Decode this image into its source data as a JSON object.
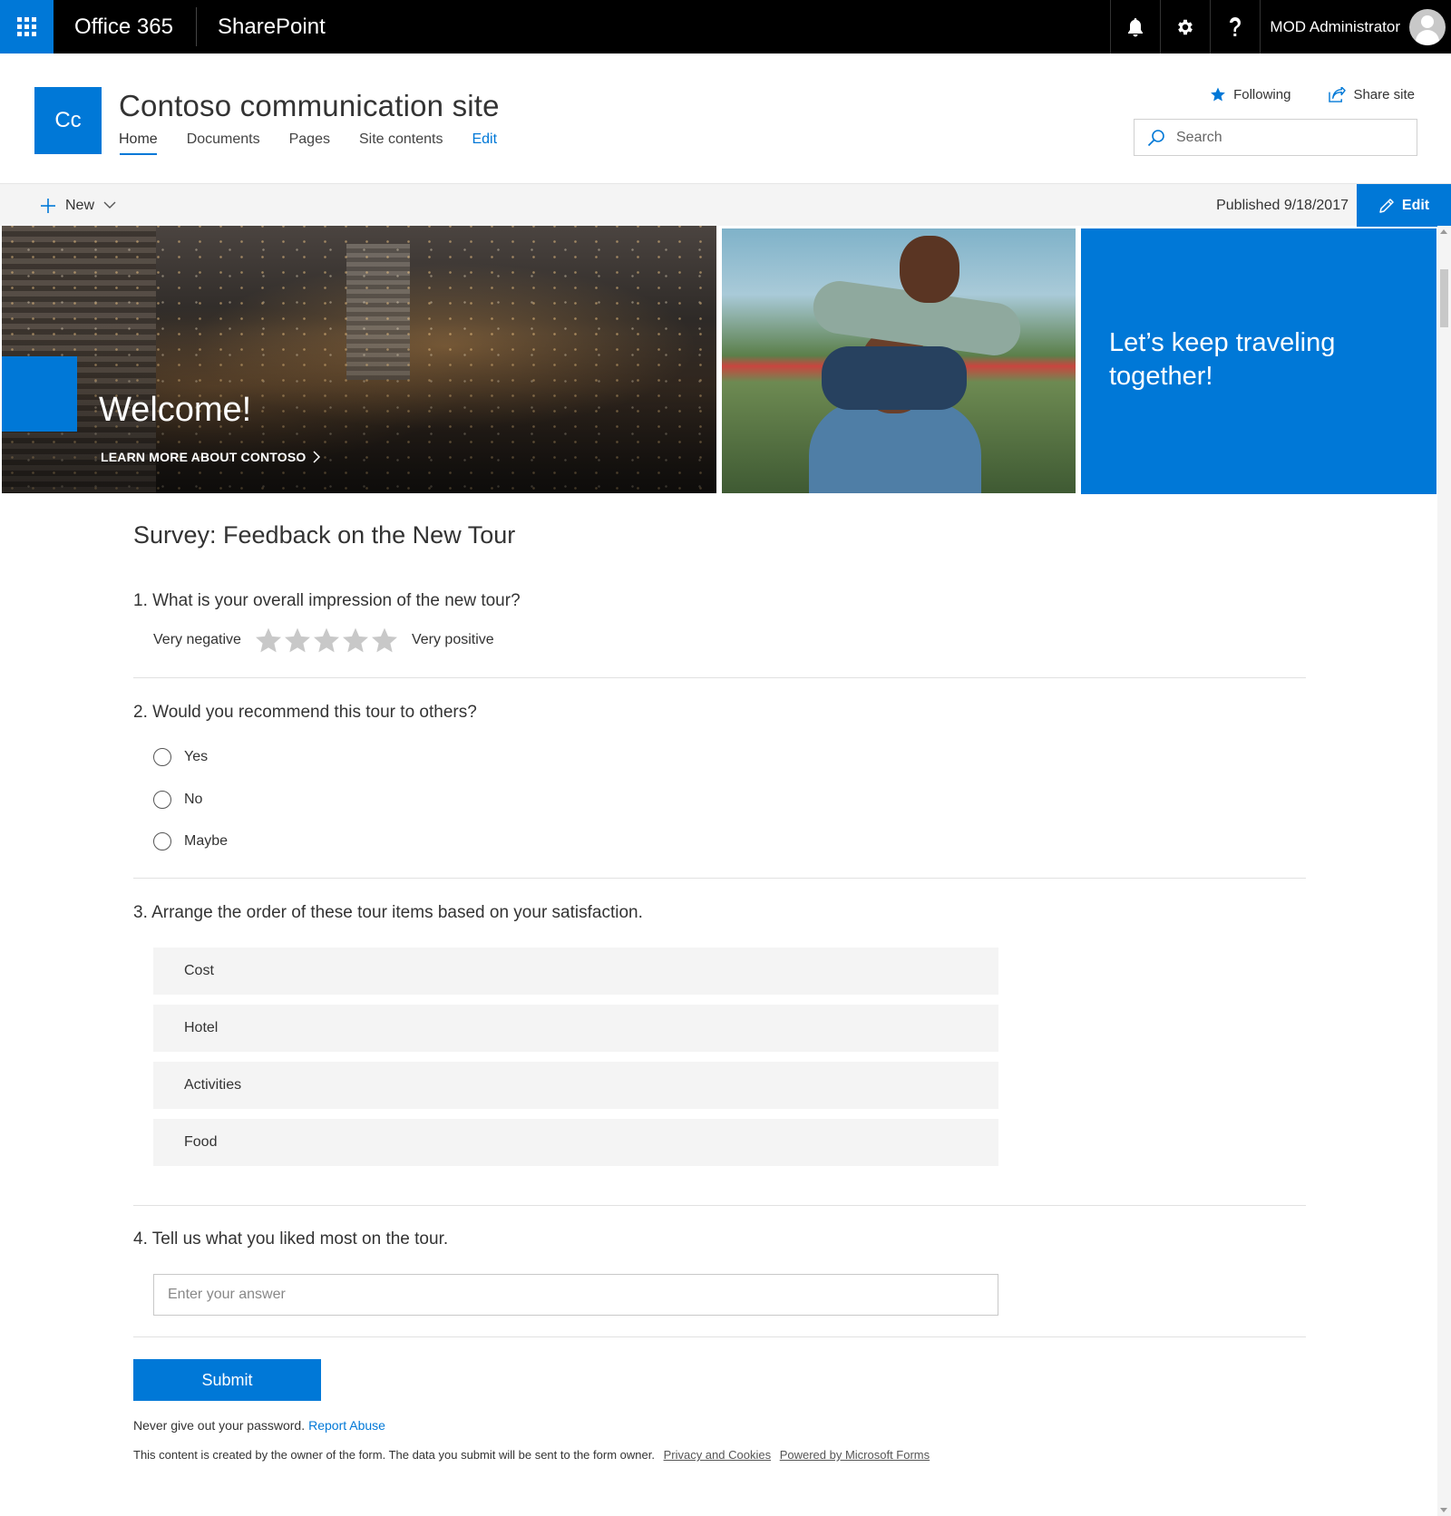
{
  "suite": {
    "app_name": "Office 365",
    "product_name": "SharePoint",
    "user_name": "MOD Administrator"
  },
  "site": {
    "logo_text": "Cc",
    "title": "Contoso communication site",
    "nav": [
      {
        "label": "Home",
        "active": true
      },
      {
        "label": "Documents"
      },
      {
        "label": "Pages"
      },
      {
        "label": "Site contents"
      },
      {
        "label": "Edit"
      }
    ],
    "following_label": "Following",
    "share_label": "Share site",
    "search_placeholder": "Search"
  },
  "command_bar": {
    "new_label": "New",
    "published_text": "Published 9/18/2017",
    "edit_label": "Edit"
  },
  "hero": {
    "main_title": "Welcome!",
    "main_link": "LEARN MORE ABOUT CONTOSO",
    "tile_text": "Let’s keep traveling together!"
  },
  "survey": {
    "title": "Survey: Feedback on the New Tour",
    "q1": {
      "title": "1. What is your overall impression of the new tour?",
      "low_label": "Very negative",
      "high_label": "Very positive",
      "star_count": 5,
      "rating_value": 0
    },
    "q2": {
      "title": "2. Would you recommend this tour to others?",
      "options": [
        "Yes",
        "No",
        "Maybe"
      ]
    },
    "q3": {
      "title": "3. Arrange the order of these tour items based on your satisfaction.",
      "items": [
        "Cost",
        "Hotel",
        "Activities",
        "Food"
      ]
    },
    "q4": {
      "title": "4. Tell us what you liked most on the tour.",
      "placeholder": "Enter your answer",
      "value": ""
    },
    "submit_label": "Submit",
    "password_note": "Never give out your password.",
    "report_abuse": "Report Abuse",
    "disclaimer": "This content is created by the owner of the form. The data you submit will be sent to the form owner.",
    "privacy_link": "Privacy and Cookies",
    "powered_link": "Powered by Microsoft Forms"
  },
  "colors": {
    "accent": "#0078d7",
    "suite_bar": "#000000",
    "command_bar": "#f4f4f4",
    "star_empty": "#c8c8c8"
  },
  "icons": [
    "app-launcher-icon",
    "bell-icon",
    "gear-icon",
    "help-icon",
    "avatar-icon",
    "star-icon",
    "share-icon",
    "search-icon",
    "plus-icon",
    "chevron-down-icon",
    "pencil-icon",
    "chevron-right-icon"
  ]
}
